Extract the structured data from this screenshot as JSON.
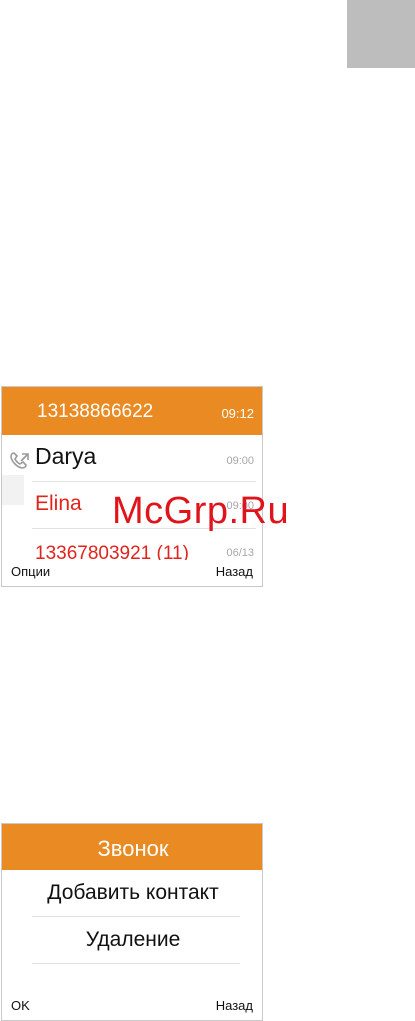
{
  "colors": {
    "accent": "#e98b22",
    "missed": "#e0241d",
    "text": "#111111",
    "muted": "#a7a7a7",
    "watermark": "#e0141b"
  },
  "call_log": {
    "items": [
      {
        "name": "13138866622",
        "time": "09:12",
        "state": "selected"
      },
      {
        "name": "Darya",
        "time": "09:00",
        "state": "outgoing",
        "icon": "outgoing-call-icon"
      },
      {
        "name": "Elina",
        "time": "09:00",
        "state": "missed"
      },
      {
        "name": "13367803921 (11)",
        "time": "06/13",
        "state": "missed"
      }
    ],
    "softkeys": {
      "left": "Опции",
      "right": "Назад"
    }
  },
  "call_menu": {
    "title": "Звонок",
    "items": [
      "Добавить контакт",
      "Удаление"
    ],
    "softkeys": {
      "left": "OK",
      "right": "Назад"
    }
  },
  "watermark": "McGrp.Ru"
}
